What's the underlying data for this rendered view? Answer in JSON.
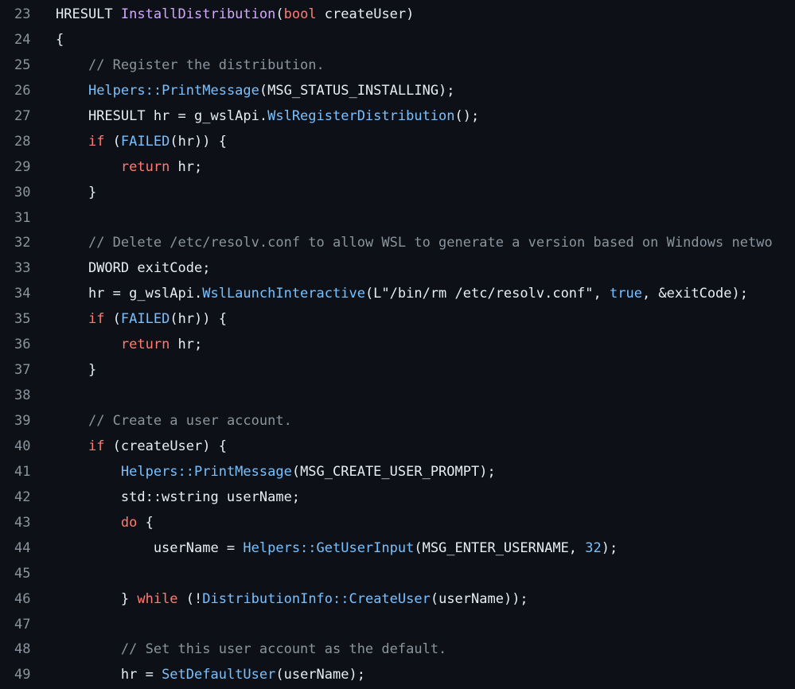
{
  "editor": {
    "background": "#0d1117",
    "colors": {
      "plain": "#e6edf3",
      "keyword": "#ff7b72",
      "function": "#d2a8ff",
      "type": "#79c0ff",
      "string": "#a5d6ff",
      "comment": "#8b949e",
      "line_number": "#8b949e"
    },
    "lines": [
      {
        "number": "23",
        "tokens": [
          {
            "t": "HRESULT ",
            "k": "plain"
          },
          {
            "t": "InstallDistribution",
            "k": "fn"
          },
          {
            "t": "(",
            "k": "plain"
          },
          {
            "t": "bool",
            "k": "kw"
          },
          {
            "t": " createUser)",
            "k": "plain"
          }
        ]
      },
      {
        "number": "24",
        "tokens": [
          {
            "t": "{",
            "k": "plain"
          }
        ]
      },
      {
        "number": "25",
        "tokens": [
          {
            "t": "    ",
            "k": "plain"
          },
          {
            "t": "// Register the distribution.",
            "k": "comment"
          }
        ]
      },
      {
        "number": "26",
        "tokens": [
          {
            "t": "    ",
            "k": "plain"
          },
          {
            "t": "Helpers::PrintMessage",
            "k": "type"
          },
          {
            "t": "(MSG_STATUS_INSTALLING);",
            "k": "plain"
          }
        ]
      },
      {
        "number": "27",
        "tokens": [
          {
            "t": "    HRESULT hr = g_wslApi.",
            "k": "plain"
          },
          {
            "t": "WslRegisterDistribution",
            "k": "type"
          },
          {
            "t": "();",
            "k": "plain"
          }
        ]
      },
      {
        "number": "28",
        "tokens": [
          {
            "t": "    ",
            "k": "plain"
          },
          {
            "t": "if",
            "k": "kw"
          },
          {
            "t": " (",
            "k": "plain"
          },
          {
            "t": "FAILED",
            "k": "type"
          },
          {
            "t": "(hr)) {",
            "k": "plain"
          }
        ]
      },
      {
        "number": "29",
        "tokens": [
          {
            "t": "        ",
            "k": "plain"
          },
          {
            "t": "return",
            "k": "kw"
          },
          {
            "t": " hr;",
            "k": "plain"
          }
        ]
      },
      {
        "number": "30",
        "tokens": [
          {
            "t": "    }",
            "k": "plain"
          }
        ]
      },
      {
        "number": "31",
        "tokens": []
      },
      {
        "number": "32",
        "tokens": [
          {
            "t": "    ",
            "k": "plain"
          },
          {
            "t": "// Delete /etc/resolv.conf to allow WSL to generate a version based on Windows netwo",
            "k": "comment"
          }
        ]
      },
      {
        "number": "33",
        "tokens": [
          {
            "t": "    DWORD exitCode;",
            "k": "plain"
          }
        ]
      },
      {
        "number": "34",
        "tokens": [
          {
            "t": "    hr = g_wslApi.",
            "k": "plain"
          },
          {
            "t": "WslLaunchInteractive",
            "k": "type"
          },
          {
            "t": "(L\"/bin/rm /etc/resolv.conf\", ",
            "k": "plain"
          },
          {
            "t": "true",
            "k": "type"
          },
          {
            "t": ", &exitCode);",
            "k": "plain"
          }
        ]
      },
      {
        "number": "35",
        "tokens": [
          {
            "t": "    ",
            "k": "plain"
          },
          {
            "t": "if",
            "k": "kw"
          },
          {
            "t": " (",
            "k": "plain"
          },
          {
            "t": "FAILED",
            "k": "type"
          },
          {
            "t": "(hr)) {",
            "k": "plain"
          }
        ]
      },
      {
        "number": "36",
        "tokens": [
          {
            "t": "        ",
            "k": "plain"
          },
          {
            "t": "return",
            "k": "kw"
          },
          {
            "t": " hr;",
            "k": "plain"
          }
        ]
      },
      {
        "number": "37",
        "tokens": [
          {
            "t": "    }",
            "k": "plain"
          }
        ]
      },
      {
        "number": "38",
        "tokens": []
      },
      {
        "number": "39",
        "tokens": [
          {
            "t": "    ",
            "k": "plain"
          },
          {
            "t": "// Create a user account.",
            "k": "comment"
          }
        ]
      },
      {
        "number": "40",
        "tokens": [
          {
            "t": "    ",
            "k": "plain"
          },
          {
            "t": "if",
            "k": "kw"
          },
          {
            "t": " (createUser) {",
            "k": "plain"
          }
        ]
      },
      {
        "number": "41",
        "tokens": [
          {
            "t": "        ",
            "k": "plain"
          },
          {
            "t": "Helpers::PrintMessage",
            "k": "type"
          },
          {
            "t": "(MSG_CREATE_USER_PROMPT);",
            "k": "plain"
          }
        ]
      },
      {
        "number": "42",
        "tokens": [
          {
            "t": "        std::wstring userName;",
            "k": "plain"
          }
        ]
      },
      {
        "number": "43",
        "tokens": [
          {
            "t": "        ",
            "k": "plain"
          },
          {
            "t": "do",
            "k": "kw"
          },
          {
            "t": " {",
            "k": "plain"
          }
        ]
      },
      {
        "number": "44",
        "tokens": [
          {
            "t": "            userName = ",
            "k": "plain"
          },
          {
            "t": "Helpers::GetUserInput",
            "k": "type"
          },
          {
            "t": "(MSG_ENTER_USERNAME, ",
            "k": "plain"
          },
          {
            "t": "32",
            "k": "num"
          },
          {
            "t": ");",
            "k": "plain"
          }
        ]
      },
      {
        "number": "45",
        "tokens": []
      },
      {
        "number": "46",
        "tokens": [
          {
            "t": "        } ",
            "k": "plain"
          },
          {
            "t": "while",
            "k": "kw"
          },
          {
            "t": " (!",
            "k": "plain"
          },
          {
            "t": "DistributionInfo::CreateUser",
            "k": "type"
          },
          {
            "t": "(userName));",
            "k": "plain"
          }
        ]
      },
      {
        "number": "47",
        "tokens": []
      },
      {
        "number": "48",
        "tokens": [
          {
            "t": "        ",
            "k": "plain"
          },
          {
            "t": "// Set this user account as the default.",
            "k": "comment"
          }
        ]
      },
      {
        "number": "49",
        "tokens": [
          {
            "t": "        hr = ",
            "k": "plain"
          },
          {
            "t": "SetDefaultUser",
            "k": "type"
          },
          {
            "t": "(userName);",
            "k": "plain"
          }
        ]
      }
    ]
  }
}
